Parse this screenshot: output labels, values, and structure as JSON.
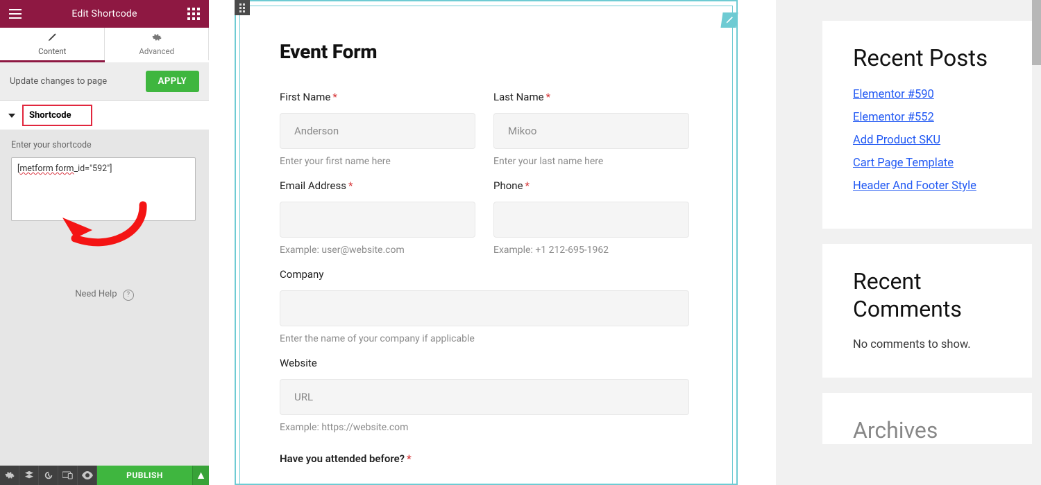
{
  "panel": {
    "header": {
      "title": "Edit Shortcode"
    },
    "tabs": {
      "content": "Content",
      "advanced": "Advanced"
    },
    "update_row": {
      "text": "Update changes to page",
      "apply": "APPLY"
    },
    "section": {
      "title": "Shortcode"
    },
    "shortcode": {
      "label": "Enter your shortcode",
      "prefix_underlined": "metform form",
      "suffix": "_id=\"592\"]"
    },
    "need_help": "Need Help",
    "footer": {
      "publish": "PUBLISH",
      "caret": "▲"
    }
  },
  "form": {
    "title": "Event Form",
    "first_name": {
      "label": "First Name",
      "placeholder": "Anderson",
      "hint": "Enter your first name here"
    },
    "last_name": {
      "label": "Last Name",
      "placeholder": "Mikoo",
      "hint": "Enter your last name here"
    },
    "email": {
      "label": "Email Address",
      "hint": "Example: user@website.com"
    },
    "phone": {
      "label": "Phone",
      "hint": "Example: +1 212-695-1962"
    },
    "company": {
      "label": "Company",
      "hint": "Enter the name of your company if applicable"
    },
    "website": {
      "label": "Website",
      "placeholder": "URL",
      "hint": "Example: https://website.com"
    },
    "attended": {
      "label": "Have you attended before?"
    }
  },
  "sidebar": {
    "recent_posts": {
      "title": "Recent Posts",
      "items": [
        "Elementor #590",
        "Elementor #552",
        "Add Product SKU",
        "Cart Page Template",
        "Header And Footer Style"
      ]
    },
    "recent_comments": {
      "title": "Recent Comments",
      "empty": "No comments to show."
    },
    "archives": {
      "title": "Archives"
    }
  }
}
